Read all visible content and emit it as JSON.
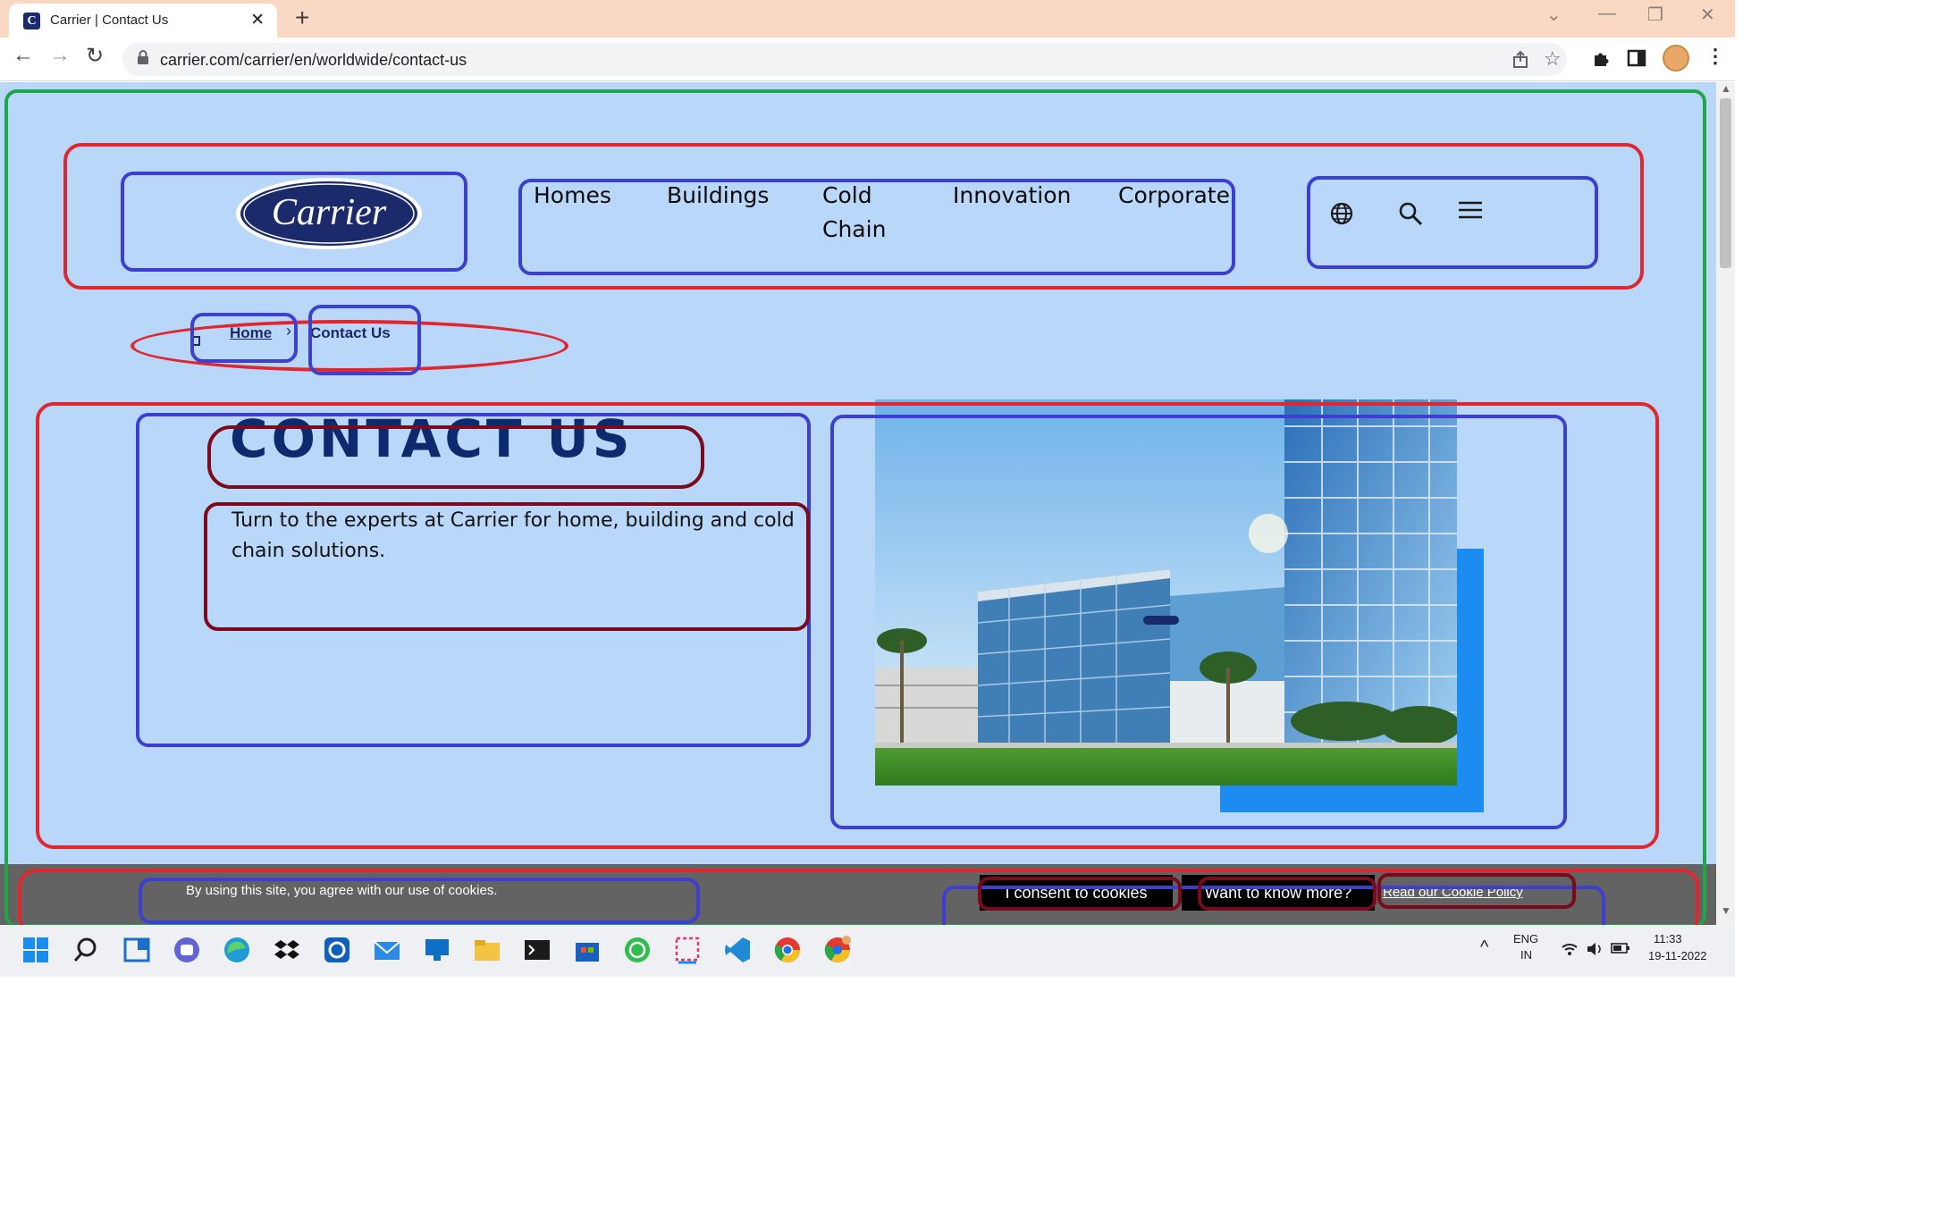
{
  "browser": {
    "tab_title": "Carrier | Contact Us",
    "tab_close": "✕",
    "new_tab": "+",
    "url": "carrier.com/carrier/en/worldwide/contact-us",
    "window_controls": [
      "⌄",
      "—",
      "❐",
      "✕"
    ],
    "nav": {
      "back": "←",
      "forward": "→",
      "reload": "↻"
    },
    "icons": [
      "share-icon",
      "star-icon",
      "extensions-icon",
      "side-panel-icon",
      "profile-avatar",
      "menu-icon"
    ]
  },
  "site": {
    "logo_text": "Carrier",
    "nav": [
      "Homes",
      "Buildings",
      "Cold Chain",
      "Innovation",
      "Corporate"
    ],
    "header_icons": [
      "globe-icon",
      "search-icon",
      "hamburger-menu-icon"
    ],
    "breadcrumb": {
      "home": "Home",
      "separator": "›",
      "current": "Contact Us"
    },
    "title": "CONTACT US",
    "subtitle": "Turn to the experts at Carrier for home, building and cold chain solutions.",
    "hero_image": "carrier-headquarters-building"
  },
  "cookie": {
    "text": "By using this site, you agree with our use of cookies.",
    "consent": "I consent to cookies",
    "more": "Want to know more?",
    "policy": "Read our Cookie Policy"
  },
  "taskbar": {
    "apps": [
      "windows-start",
      "search",
      "widgets",
      "teams-chat",
      "edge",
      "dropbox",
      "app-store-blue",
      "mail",
      "remote-desktop",
      "file-explorer",
      "terminal",
      "microsoft-store",
      "whatsapp",
      "snipping-tool",
      "vscode",
      "chrome",
      "chrome-profile"
    ],
    "lang_top": "ENG",
    "lang_bottom": "IN",
    "time": "11:33",
    "date": "19-11-2022",
    "tray_chevron": "^"
  },
  "colors": {
    "page_bg": "#b9d7f9",
    "brand_navy": "#1b2a6b",
    "accent_blue": "#1d8cf0",
    "annotation_red": "#e0262f",
    "annotation_blue": "#3c3fd0",
    "annotation_green": "#20a54a",
    "cookie_bar": "#636363"
  }
}
